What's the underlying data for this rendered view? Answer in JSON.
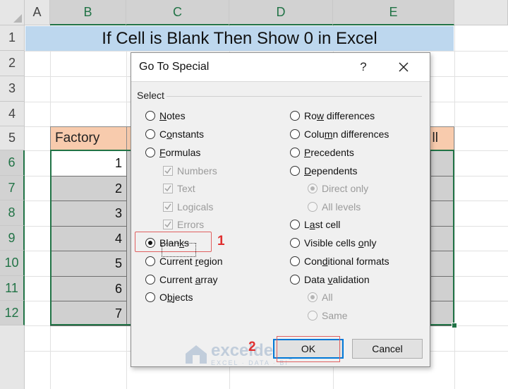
{
  "sheet": {
    "columns": [
      "A",
      "B",
      "C",
      "D",
      "E"
    ],
    "rows": [
      "1",
      "2",
      "3",
      "4",
      "5",
      "6",
      "7",
      "8",
      "9",
      "10",
      "11",
      "12"
    ],
    "title": "If Cell is Blank Then Show 0 in Excel",
    "header_left": "Factory",
    "header_right_fragment": "ll",
    "values": [
      "1",
      "2",
      "3",
      "4",
      "5",
      "6",
      "7"
    ],
    "accent_color": "#217346"
  },
  "dialog": {
    "title": "Go To Special",
    "help_label": "?",
    "group_label": "Select",
    "left_options": [
      {
        "label": "Notes",
        "ul": 0
      },
      {
        "label": "Constants",
        "ul": 1
      },
      {
        "label": "Formulas",
        "ul": 0
      }
    ],
    "formula_subs": [
      "Numbers",
      "Text",
      "Logicals",
      "Errors"
    ],
    "left_options2": [
      {
        "label": "Blanks",
        "ul": 4,
        "checked": true
      },
      {
        "label": "Current region",
        "ul": 8
      },
      {
        "label": "Current array",
        "ul": 8
      },
      {
        "label": "Objects",
        "ul": 1
      }
    ],
    "right_options": [
      {
        "label": "Row differences",
        "ul": 2
      },
      {
        "label": "Column differences",
        "ul": 4
      },
      {
        "label": "Precedents",
        "ul": 0
      },
      {
        "label": "Dependents",
        "ul": 0
      }
    ],
    "dep_subs": [
      "Direct only",
      "All levels"
    ],
    "right_options2": [
      {
        "label": "Last cell",
        "ul": 1
      },
      {
        "label": "Visible cells only",
        "ul": 14
      },
      {
        "label": "Conditional formats",
        "ul": 3
      },
      {
        "label": "Data validation",
        "ul": 5
      }
    ],
    "validation_subs": [
      "All",
      "Same"
    ],
    "ok_label": "OK",
    "cancel_label": "Cancel"
  },
  "callouts": {
    "step1": "1",
    "step2": "2"
  },
  "watermark": {
    "brand": "exceldemy",
    "tagline": "EXCEL · DATA · BI"
  }
}
